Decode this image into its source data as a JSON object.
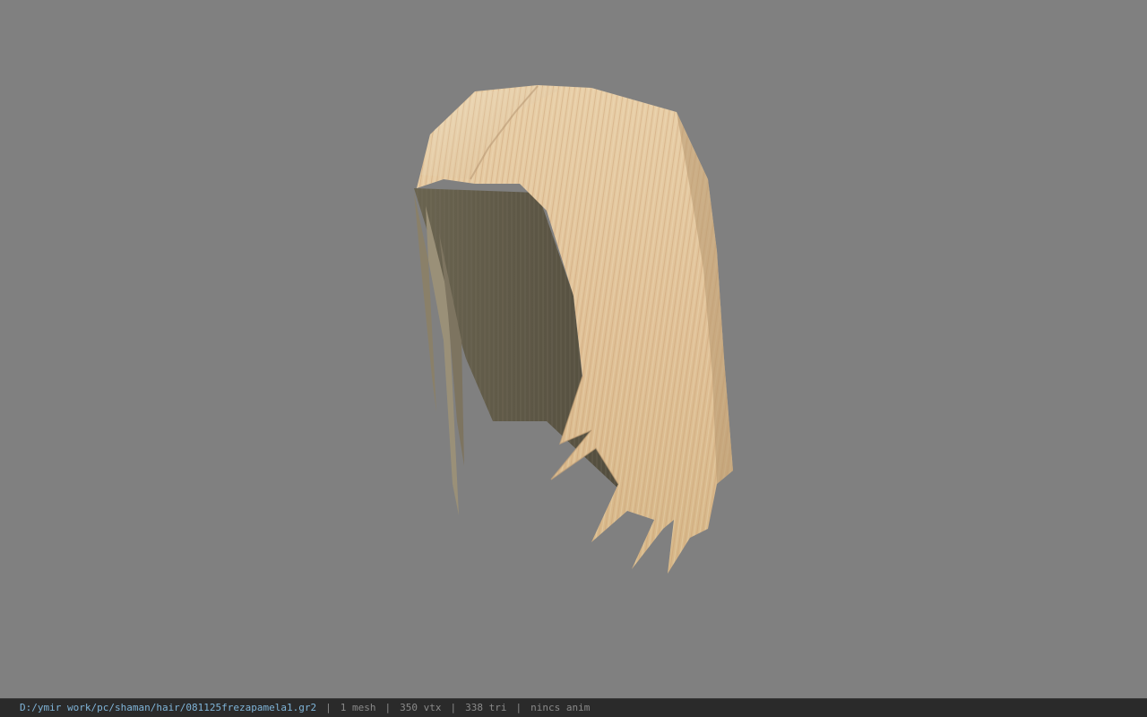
{
  "viewer": {
    "background_color": "#808080",
    "model_colors": {
      "hair_light": "#e6c9a0",
      "hair_mid": "#d9b68c",
      "hair_shadow": "#b99a74",
      "inner_dark": "#5e5746",
      "inner_mid": "#6f6955"
    }
  },
  "statusbar": {
    "file_path": "D:/ymir work/pc/shaman/hair/081125frezapamela1.gr2",
    "separator": "|",
    "mesh_count": "1 mesh",
    "vertex_count": "350 vtx",
    "triangle_count": "338 tri",
    "anim_info": "nincs anim",
    "path_color": "#7fb4d8",
    "text_color": "#8a8a8a",
    "background_color": "#2a2a2a"
  }
}
